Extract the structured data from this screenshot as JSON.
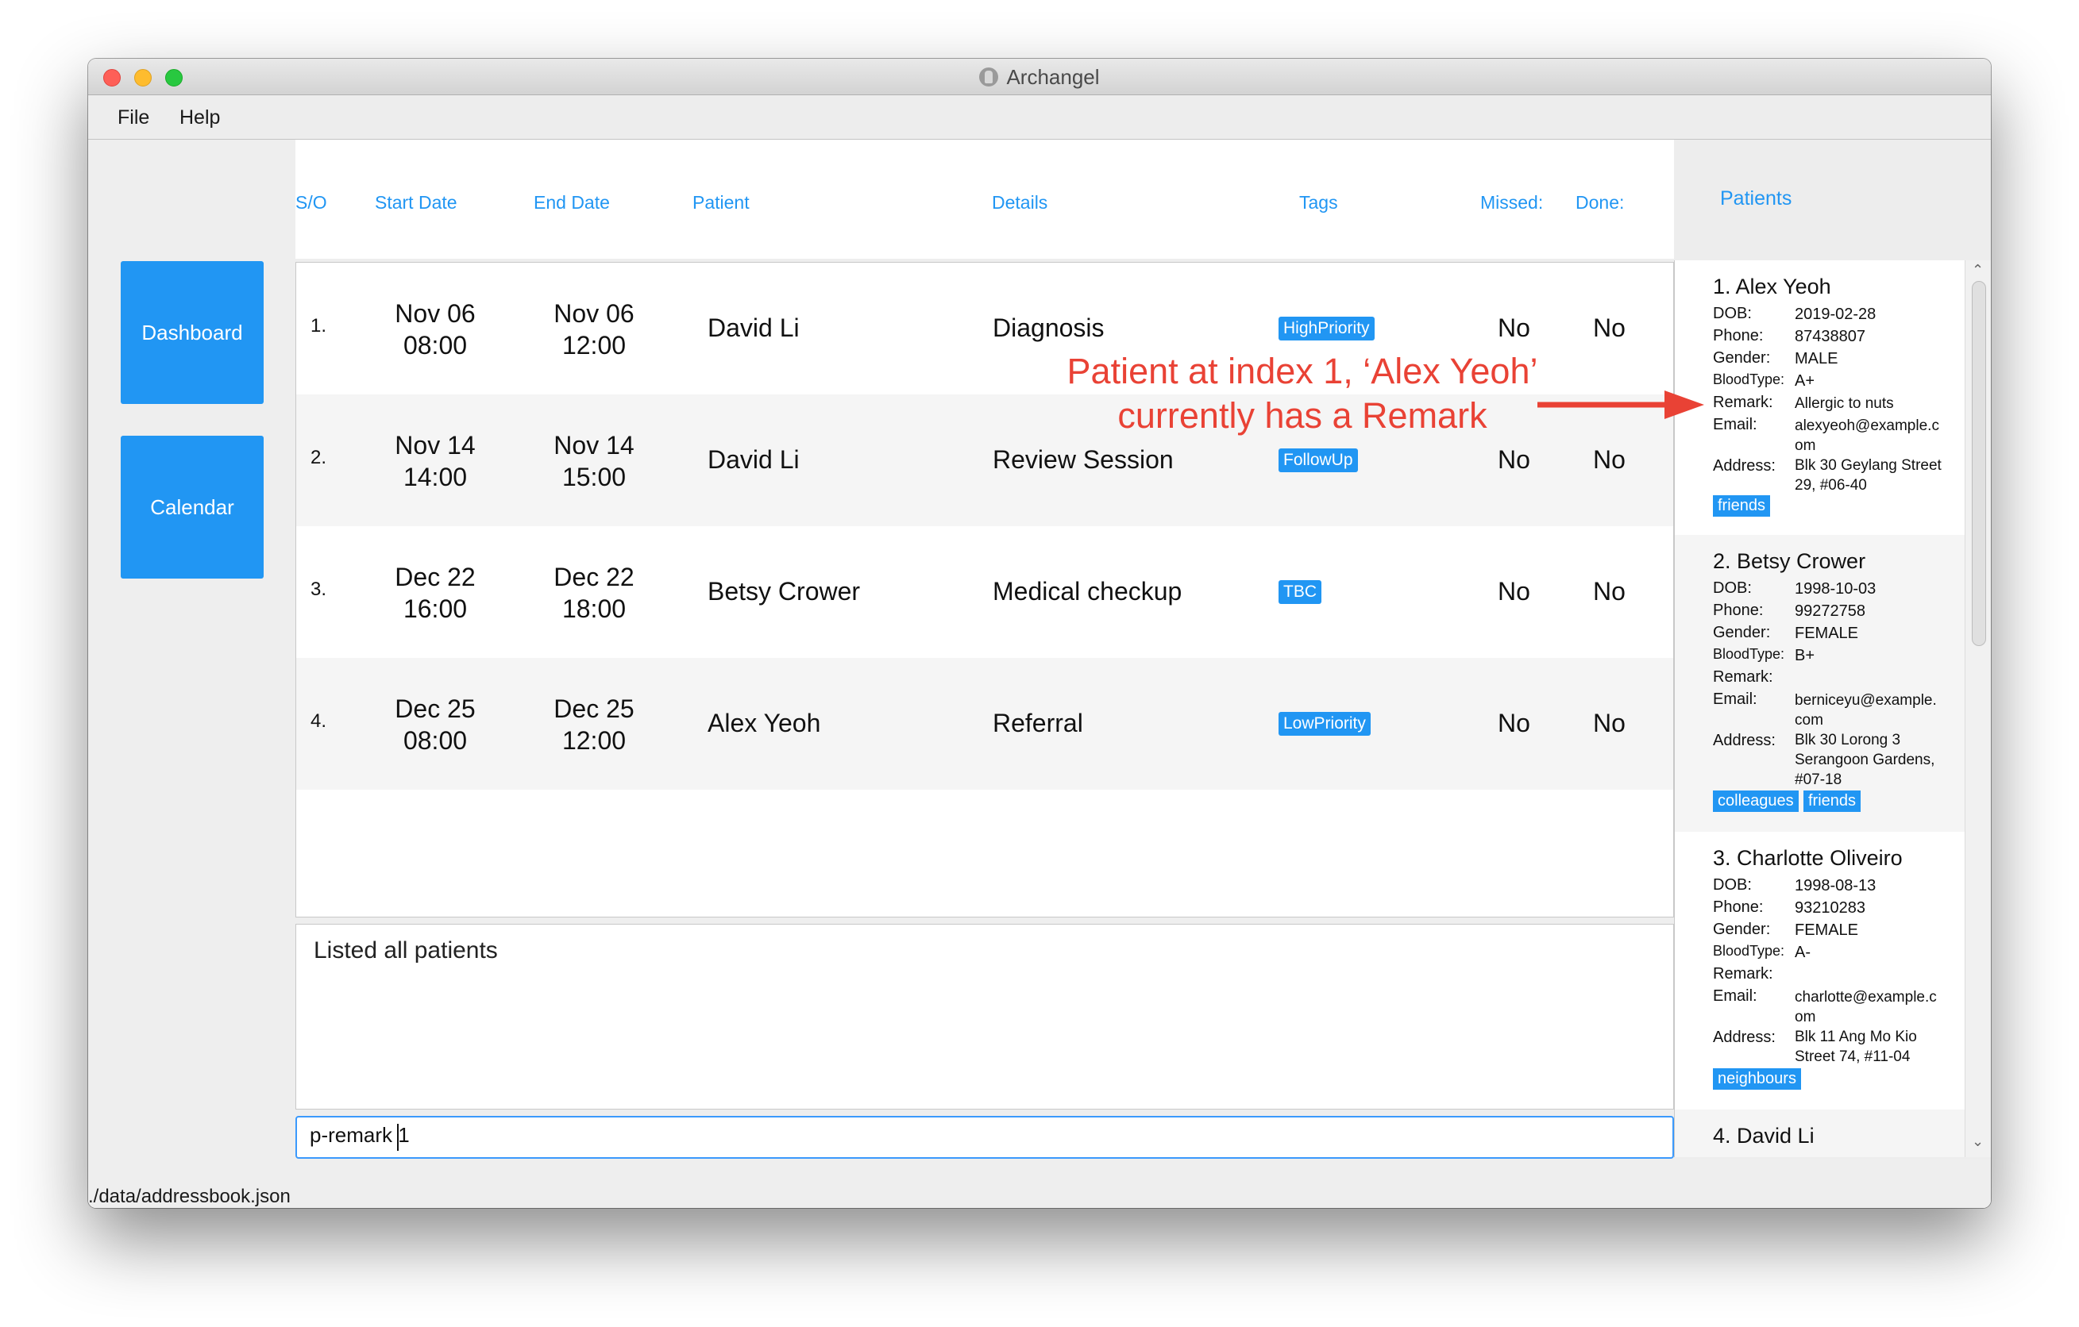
{
  "window": {
    "title": "Archangel"
  },
  "menu": {
    "file": "File",
    "help": "Help"
  },
  "sidebar": {
    "dashboard": "Dashboard",
    "calendar": "Calendar"
  },
  "table": {
    "headers": {
      "so": "S/O",
      "start": "Start Date",
      "end": "End Date",
      "patient": "Patient",
      "details": "Details",
      "tags": "Tags",
      "missed": "Missed:",
      "done": "Done:"
    },
    "rows": [
      {
        "index": "1.",
        "start_date": "Nov 06",
        "start_time": "08:00",
        "end_date": "Nov 06",
        "end_time": "12:00",
        "patient": "David Li",
        "details": "Diagnosis",
        "tag": "HighPriority",
        "missed": "No",
        "done": "No"
      },
      {
        "index": "2.",
        "start_date": "Nov 14",
        "start_time": "14:00",
        "end_date": "Nov 14",
        "end_time": "15:00",
        "patient": "David Li",
        "details": "Review Session",
        "tag": "FollowUp",
        "missed": "No",
        "done": "No"
      },
      {
        "index": "3.",
        "start_date": "Dec 22",
        "start_time": "16:00",
        "end_date": "Dec 22",
        "end_time": "18:00",
        "patient": "Betsy Crower",
        "details": "Medical checkup",
        "tag": "TBC",
        "missed": "No",
        "done": "No"
      },
      {
        "index": "4.",
        "start_date": "Dec 25",
        "start_time": "08:00",
        "end_date": "Dec 25",
        "end_time": "12:00",
        "patient": "Alex Yeoh",
        "details": "Referral",
        "tag": "LowPriority",
        "missed": "No",
        "done": "No"
      }
    ]
  },
  "result": {
    "text": "Listed all patients"
  },
  "command": {
    "value": "p-remark 1"
  },
  "status": {
    "path": "./data/addressbook.json"
  },
  "patients_panel": {
    "title": "Patients",
    "labels": {
      "dob": "DOB:",
      "phone": "Phone:",
      "gender": "Gender:",
      "blood": "BloodType:",
      "remark": "Remark:",
      "email": "Email:",
      "address": "Address:"
    },
    "patients": [
      {
        "name": "1. Alex Yeoh",
        "dob": "2019-02-28",
        "phone": "87438807",
        "gender": "MALE",
        "blood": "A+",
        "remark": "Allergic to nuts",
        "email": "alexyeoh@example.c om",
        "address": "Blk 30 Geylang Street 29, #06-40",
        "tags": [
          "friends"
        ]
      },
      {
        "name": "2. Betsy Crower",
        "dob": "1998-10-03",
        "phone": "99272758",
        "gender": "FEMALE",
        "blood": "B+",
        "remark": "",
        "email": "berniceyu@example. com",
        "address": "Blk 30 Lorong 3 Serangoon Gardens, #07-18",
        "tags": [
          "colleagues",
          "friends"
        ]
      },
      {
        "name": "3. Charlotte Oliveiro",
        "dob": "1998-08-13",
        "phone": "93210283",
        "gender": "FEMALE",
        "blood": "A-",
        "remark": "",
        "email": "charlotte@example.c om",
        "address": "Blk 11 Ang Mo Kio Street 74, #11-04",
        "tags": [
          "neighbours"
        ]
      },
      {
        "name": "4. David Li"
      }
    ]
  },
  "annotation": {
    "text": "Patient at index 1, ‘Alex Yeoh’ currently has a Remark",
    "color": "#e94235"
  },
  "colors": {
    "accent": "#2196f3"
  }
}
